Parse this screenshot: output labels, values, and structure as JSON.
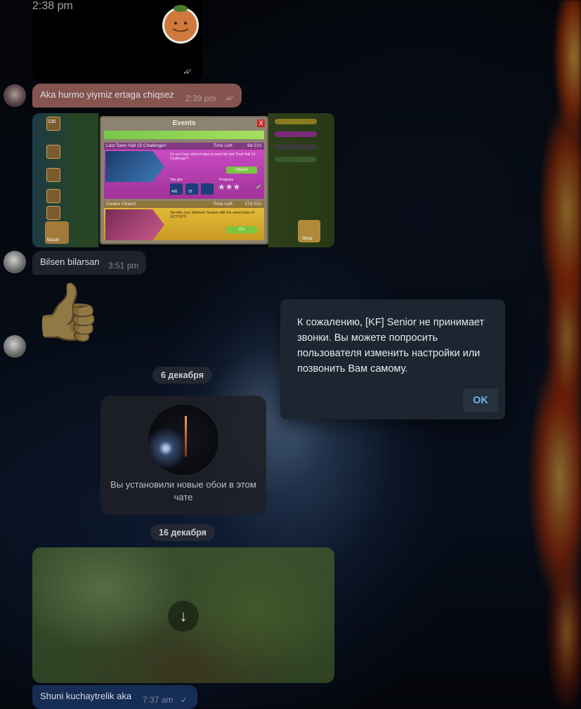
{
  "messages": [
    {
      "type": "sticker",
      "time": "2:38 pm",
      "ticks": "✓✓"
    },
    {
      "type": "text",
      "text": "Aka hurmo yiymiz ertaga chiqsez",
      "time": "2:39 pm",
      "ticks": "✓✓"
    },
    {
      "type": "photo",
      "game_panel": {
        "title": "Events",
        "close": "X",
        "event1_title": "Last Town Hall 15 Challenge!!",
        "event1_timeleft": "Time Left:",
        "event1_time": "6d 21h",
        "event1_desc": "Do you have what it takes to beat the last Town Hall 15 Challenge?!",
        "event1_button": "Attack!",
        "you_got": "You got:",
        "progress": "Progress",
        "reward1": "400",
        "reward2": "25",
        "event2_title": "Cookie Chaos!",
        "event2_timeleft": "Time Left:",
        "event2_time": "27d 21h",
        "event2_desc": "Sprinkle your Stationer Season with the sweet taste of VICTORY!",
        "event2_button": "Go",
        "attack_label": "Attack!",
        "level": "130",
        "shop": "Shop"
      }
    },
    {
      "type": "text",
      "text": "Bilsen bilarsan",
      "time": "3:51 pm"
    },
    {
      "type": "sticker",
      "emoji": "👍"
    }
  ],
  "date_separators": [
    "6 декабря",
    "16 декабря"
  ],
  "service_message": {
    "text": "Вы установили новые обои в этом чате"
  },
  "last_message": {
    "text": "Shuni kuchaytrelik aka",
    "time": "7:37 am",
    "tick": "✓"
  },
  "video": {
    "download_icon": "↓"
  },
  "dialog": {
    "message": "К сожалению, [KF] Senior не принимает звонки. Вы можете попросить пользователя изменить настройки или позвонить Вам самому.",
    "ok_label": "OK"
  },
  "colors": {
    "outgoing_bubble": "#a3655d",
    "incoming_bubble": "#2a2d33",
    "accent": "#6ab2f2",
    "dialog_bg": "#1c2530"
  }
}
